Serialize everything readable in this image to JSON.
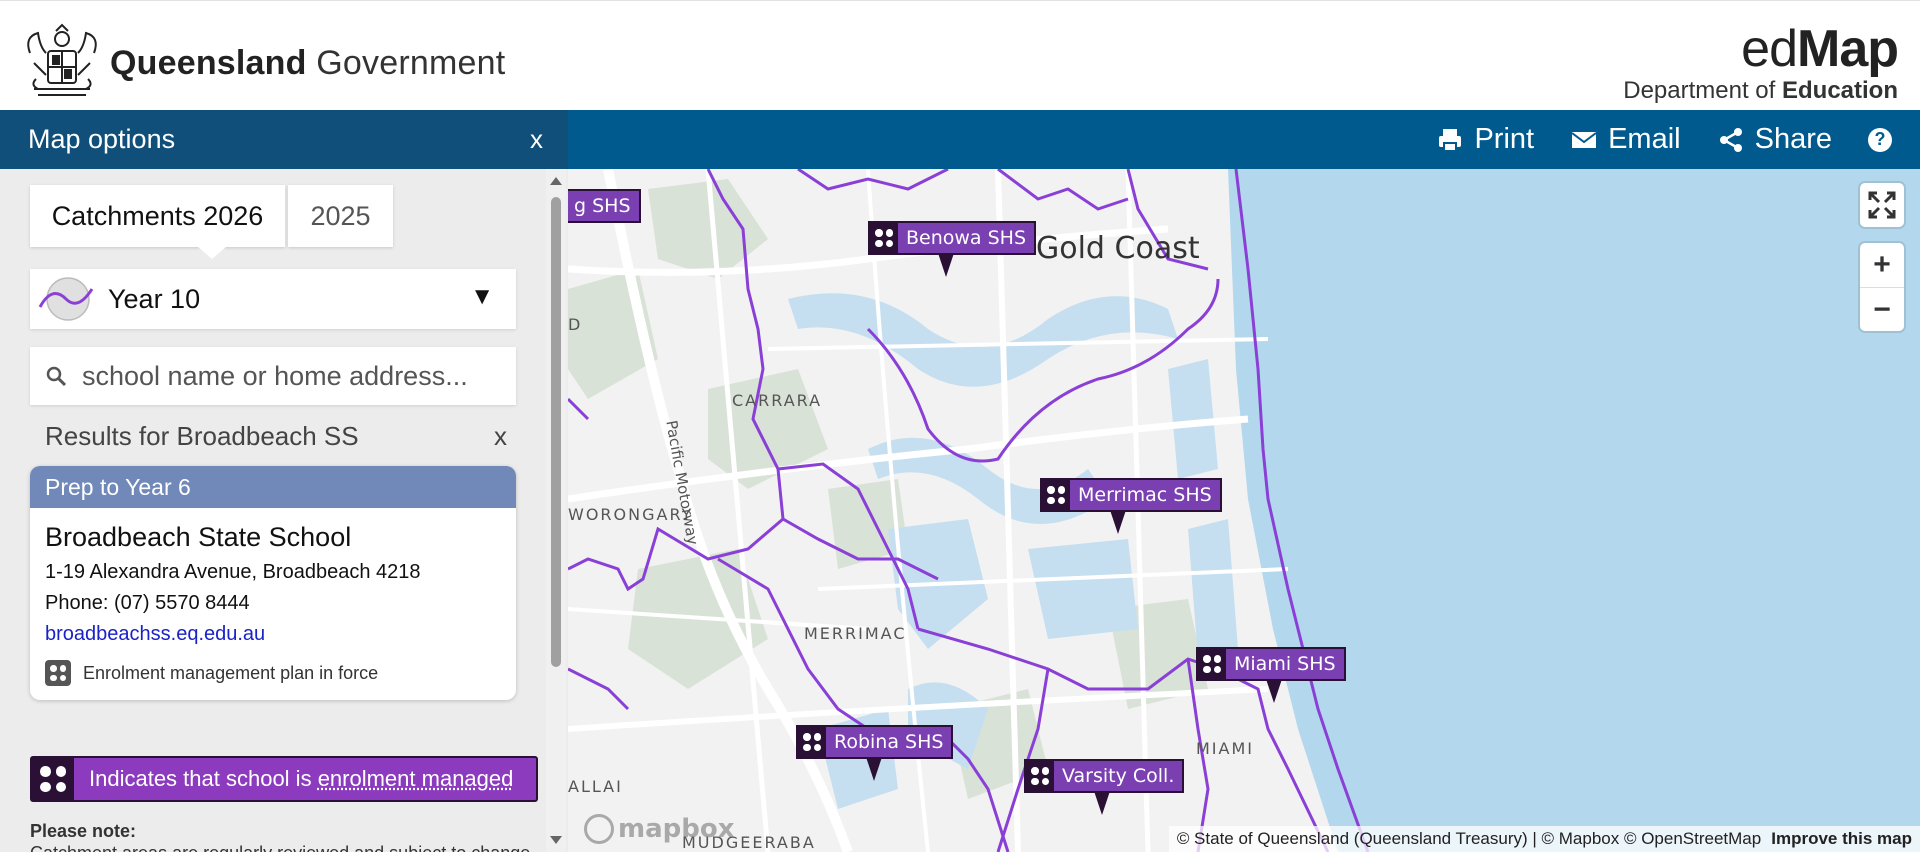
{
  "header": {
    "org_name_bold": "Queensland",
    "org_name_rest": " Government",
    "app_name_light": "ed",
    "app_name_bold": "Map",
    "dept_light": "Department of ",
    "dept_bold": "Education"
  },
  "topbar": {
    "panel_title": "Map options",
    "panel_close": "x",
    "print_label": "Print",
    "email_label": "Email",
    "share_label": "Share",
    "help_label": "?"
  },
  "sidebar": {
    "tabs": [
      {
        "label": "Catchments 2026",
        "active": true
      },
      {
        "label": "2025",
        "active": false
      }
    ],
    "year_select": {
      "value": "Year 10",
      "arrow": "▼"
    },
    "search": {
      "placeholder": "school name or home address..."
    },
    "results": {
      "heading": "Results for Broadbeach SS",
      "close": "x"
    },
    "card": {
      "category": "Prep to Year 6",
      "school_name": "Broadbeach State School",
      "address": "1-19 Alexandra Avenue, Broadbeach 4218",
      "phone": "Phone: (07) 5570 8444",
      "website": "broadbeachss.eq.edu.au",
      "enrolment_note": "Enrolment management plan in force"
    },
    "legend": {
      "text_before": "Indicates that school is ",
      "text_underlined": "enrolment managed"
    },
    "note_title": "Please note:",
    "note_text": "Catchment areas are regularly reviewed and subject to change."
  },
  "map": {
    "city_label": "Gold Coast",
    "place_labels": [
      {
        "text": "CARRARA"
      },
      {
        "text": "WORONGARY"
      },
      {
        "text": "MERRIMAC"
      },
      {
        "text": "MIAMI"
      },
      {
        "text": "MUDGEERABA"
      },
      {
        "text": "ALLAI"
      },
      {
        "text": "D"
      }
    ],
    "road_label": "Pacific Motorway",
    "schools": [
      {
        "name": "g SHS"
      },
      {
        "name": "Benowa SHS"
      },
      {
        "name": "Merrimac SHS"
      },
      {
        "name": "Miami SHS"
      },
      {
        "name": "Robina SHS"
      },
      {
        "name": "Varsity Coll."
      }
    ],
    "zoom_in": "+",
    "zoom_out": "−",
    "mapbox_logo": "mapbox",
    "attribution": "© State of Queensland (Queensland Treasury) | © Mapbox © OpenStreetMap",
    "improve_link": "Improve this map"
  },
  "colors": {
    "topbar": "#005a8e",
    "panel_title_bg": "#0f4f7a",
    "card_header": "#7089b8",
    "catchment_line": "#8a3fd6",
    "school_pin": "#7a3fb0",
    "ocean": "#b3d7ec",
    "water": "#c5dff0",
    "link": "#1a22c8"
  }
}
